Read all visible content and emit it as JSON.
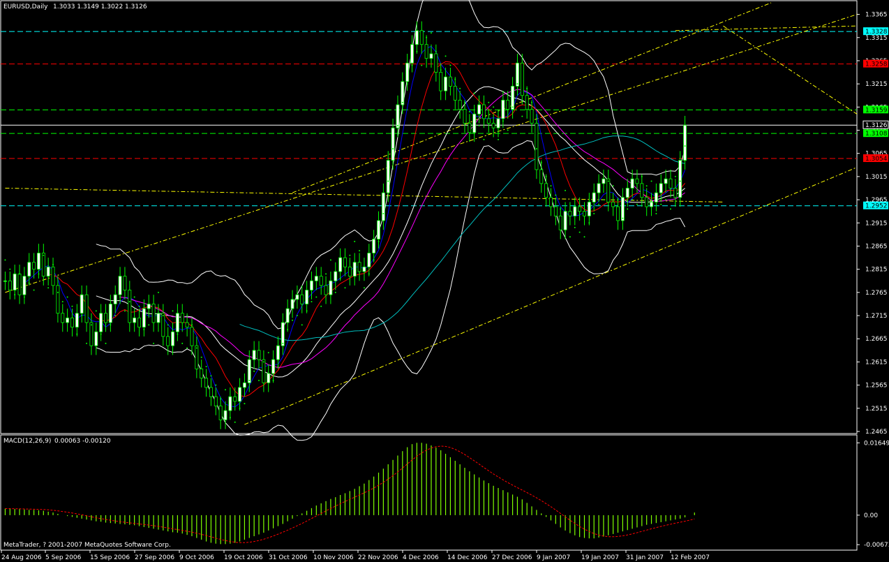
{
  "header": {
    "symbol_info": "EURUSD,Daily",
    "ohlc": "1.3033 1.3149 1.3022 1.3126"
  },
  "macd_header": {
    "label": "MACD(12,26,9)",
    "values": "0.00063 -0.00120"
  },
  "copyright": "MetaTrader, ? 2001-2007 MetaQuotes Software Corp.",
  "colors": {
    "background": "#000000",
    "bull_candle": "#ffffff",
    "bear_candle": "#000000",
    "wick": "#00ff00",
    "cyan_line": "#00ffff",
    "red_line": "#ff0000",
    "green_line": "#00ff00",
    "yellow_line": "#ffff00",
    "ma_red": "#ff0000",
    "ma_blue": "#0000ff",
    "ma_magenta": "#ff00ff",
    "ma_cyan": "#00c0c0",
    "bands": "#ffffff",
    "macd_hist": "#7fff00",
    "macd_signal": "#ff0000"
  },
  "chart_data": [
    {
      "type": "candlestick",
      "title": "EURUSD,Daily",
      "ylim": [
        1.2465,
        1.339
      ],
      "y_ticks": [
        "1.3365",
        "1.3315",
        "1.3265",
        "1.3215",
        "1.3165",
        "1.3115",
        "1.3065",
        "1.3015",
        "1.2965",
        "1.2915",
        "1.2865",
        "1.2815",
        "1.2765",
        "1.2715",
        "1.2665",
        "1.2615",
        "1.2565",
        "1.2515",
        "1.2465"
      ],
      "x_ticks": [
        "24 Aug 2006",
        "5 Sep 2006",
        "15 Sep 2006",
        "27 Sep 2006",
        "9 Oct 2006",
        "19 Oct 2006",
        "31 Oct 2006",
        "10 Nov 2006",
        "22 Nov 2006",
        "4 Dec 2006",
        "14 Dec 2006",
        "27 Dec 2006",
        "9 Jan 2007",
        "19 Jan 2007",
        "31 Jan 2007",
        "12 Feb 2007"
      ],
      "close": [
        1.279,
        1.277,
        1.2805,
        1.276,
        1.28,
        1.283,
        1.2815,
        1.285,
        1.28,
        1.282,
        1.278,
        1.272,
        1.27,
        1.271,
        1.269,
        1.272,
        1.276,
        1.27,
        1.265,
        1.268,
        1.272,
        1.27,
        1.274,
        1.276,
        1.28,
        1.277,
        1.27,
        1.271,
        1.269,
        1.273,
        1.274,
        1.27,
        1.272,
        1.267,
        1.265,
        1.268,
        1.272,
        1.27,
        1.269,
        1.265,
        1.26,
        1.258,
        1.256,
        1.254,
        1.252,
        1.249,
        1.251,
        1.254,
        1.253,
        1.256,
        1.257,
        1.262,
        1.264,
        1.262,
        1.257,
        1.259,
        1.262,
        1.265,
        1.27,
        1.273,
        1.275,
        1.276,
        1.274,
        1.277,
        1.279,
        1.28,
        1.278,
        1.276,
        1.279,
        1.281,
        1.284,
        1.282,
        1.28,
        1.283,
        1.281,
        1.282,
        1.285,
        1.288,
        1.292,
        1.298,
        1.305,
        1.312,
        1.317,
        1.322,
        1.326,
        1.33,
        1.333,
        1.33,
        1.327,
        1.328,
        1.324,
        1.32,
        1.323,
        1.321,
        1.318,
        1.316,
        1.313,
        1.311,
        1.315,
        1.317,
        1.314,
        1.313,
        1.312,
        1.314,
        1.318,
        1.316,
        1.321,
        1.326,
        1.319,
        1.316,
        1.313,
        1.303,
        1.3,
        1.297,
        1.295,
        1.293,
        1.29,
        1.294,
        1.293,
        1.295,
        1.294,
        1.293,
        1.296,
        1.298,
        1.3,
        1.301,
        1.296,
        1.295,
        1.292,
        1.297,
        1.299,
        1.301,
        1.3,
        1.297,
        1.295,
        1.296,
        1.298,
        1.3,
        1.301,
        1.299,
        1.297,
        1.305,
        1.3126
      ],
      "series": [
        {
          "name": "MACD(12,26,9)",
          "type": "histogram"
        },
        {
          "name": "signal",
          "type": "line"
        }
      ],
      "horizontal_levels": [
        {
          "value": "1.3328",
          "color": "#00ffff",
          "style": "dash"
        },
        {
          "value": "1.3258",
          "color": "#ff0000",
          "style": "dash"
        },
        {
          "value": "1.3159",
          "color": "#00ff00",
          "style": "dash"
        },
        {
          "value": "1.3126",
          "color": "#ffffff",
          "style": "solid"
        },
        {
          "value": "1.3108",
          "color": "#00ff00",
          "style": "dash"
        },
        {
          "value": "1.3054",
          "color": "#ff0000",
          "style": "dash"
        },
        {
          "value": "1.2952",
          "color": "#00ffff",
          "style": "dash"
        }
      ],
      "grid": false,
      "legend": "none"
    },
    {
      "type": "bar",
      "title": "MACD(12,26,9)",
      "y_ticks": [
        "0.01649",
        "0.00",
        "-0.00673"
      ],
      "ylim": [
        -0.0075,
        0.0175
      ],
      "values": [
        0.0015,
        0.0015,
        0.0014,
        0.0014,
        0.0013,
        0.0012,
        0.0012,
        0.0011,
        0.001,
        0.0008,
        0.0006,
        0.0003,
        0.0,
        -0.0002,
        -0.0004,
        -0.0006,
        -0.0008,
        -0.001,
        -0.0012,
        -0.0014,
        -0.0015,
        -0.0017,
        -0.0018,
        -0.0019,
        -0.002,
        -0.0021,
        -0.0022,
        -0.0023,
        -0.0025,
        -0.0027,
        -0.0029,
        -0.0031,
        -0.0033,
        -0.0035,
        -0.0037,
        -0.0039,
        -0.004,
        -0.0042,
        -0.0045,
        -0.0048,
        -0.0052,
        -0.0056,
        -0.006,
        -0.0063,
        -0.0065,
        -0.0066,
        -0.0066,
        -0.0065,
        -0.0063,
        -0.006,
        -0.0056,
        -0.0052,
        -0.0048,
        -0.0044,
        -0.004,
        -0.0035,
        -0.003,
        -0.0025,
        -0.002,
        -0.0014,
        -0.0008,
        -0.0002,
        0.0004,
        0.001,
        0.0016,
        0.0022,
        0.0027,
        0.0032,
        0.0037,
        0.0041,
        0.0046,
        0.005,
        0.0055,
        0.006,
        0.0066,
        0.0072,
        0.008,
        0.0088,
        0.0097,
        0.0106,
        0.0116,
        0.0126,
        0.0136,
        0.0146,
        0.0155,
        0.0162,
        0.0165,
        0.0165,
        0.0163,
        0.0159,
        0.0154,
        0.0148,
        0.014,
        0.0132,
        0.0124,
        0.0116,
        0.0108,
        0.01,
        0.0093,
        0.0086,
        0.0079,
        0.0073,
        0.0067,
        0.0062,
        0.0057,
        0.0052,
        0.0047,
        0.0042,
        0.0036,
        0.0028,
        0.002,
        0.0012,
        0.0004,
        -0.0004,
        -0.0012,
        -0.002,
        -0.0028,
        -0.0035,
        -0.0041,
        -0.0046,
        -0.005,
        -0.0052,
        -0.0053,
        -0.0053,
        -0.0051,
        -0.0049,
        -0.0046,
        -0.0043,
        -0.004,
        -0.0037,
        -0.0034,
        -0.0031,
        -0.0028,
        -0.0025,
        -0.0022,
        -0.002,
        -0.0018,
        -0.0016,
        -0.0014,
        -0.0012,
        -0.001,
        -0.0008,
        -0.0005,
        0.0,
        0.0006
      ]
    }
  ]
}
